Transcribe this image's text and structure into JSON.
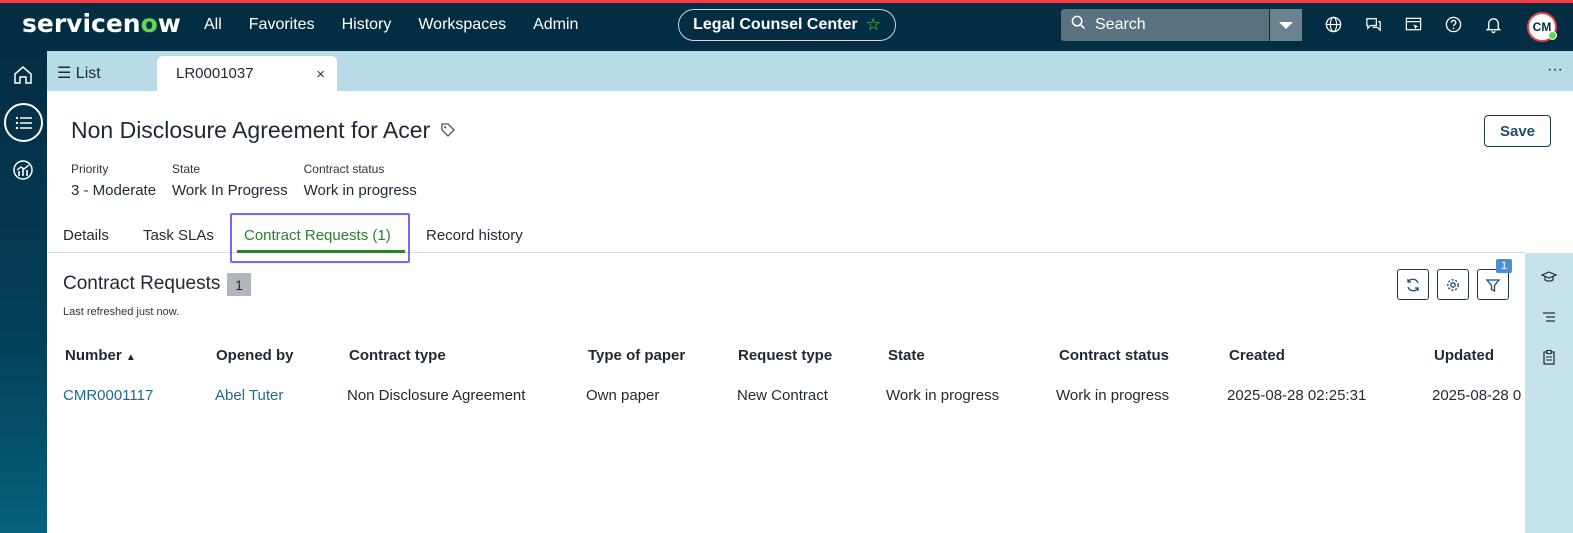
{
  "topbar": {
    "logo_main": "servicen",
    "logo_o": "o",
    "logo_end": "w",
    "nav": [
      "All",
      "Favorites",
      "History",
      "Workspaces",
      "Admin"
    ],
    "workspace": "Legal Counsel Center",
    "search_placeholder": "Search",
    "icons": [
      "globe-icon",
      "chat-icon",
      "screen-icon",
      "help-icon",
      "bell-icon"
    ],
    "avatar_initials": "CM"
  },
  "tabstrip": {
    "list_label": "List",
    "record_tab": "LR0001037",
    "close": "×",
    "more": "···"
  },
  "record": {
    "title": "Non Disclosure Agreement for Acer",
    "save_label": "Save",
    "fields": [
      {
        "label": "Priority",
        "value": "3 - Moderate"
      },
      {
        "label": "State",
        "value": "Work In Progress"
      },
      {
        "label": "Contract status",
        "value": "Work in progress"
      }
    ]
  },
  "tabs": [
    "Details",
    "Task SLAs",
    "Contract Requests (1)",
    "Record history"
  ],
  "related_list": {
    "title": "Contract Requests",
    "count": "1",
    "refreshed": "Last refreshed just now.",
    "filter_badge": "1",
    "columns": [
      "Number",
      "Opened by",
      "Contract type",
      "Type of paper",
      "Request type",
      "State",
      "Contract status",
      "Created",
      "Updated"
    ],
    "sort_indicator": "▲",
    "rows": [
      [
        "CMR0001117",
        "Abel Tuter",
        "Non Disclosure Agreement",
        "Own paper",
        "New Contract",
        "Work in progress",
        "Work in progress",
        "2025-08-28 02:25:31",
        "2025-08-28 0"
      ]
    ]
  },
  "colors": {
    "topbar": "#032d42",
    "accent_green": "#62d84e",
    "active_tab": "#2e7d32",
    "link": "#1d6a8c",
    "highlight": "#7b61ff"
  }
}
